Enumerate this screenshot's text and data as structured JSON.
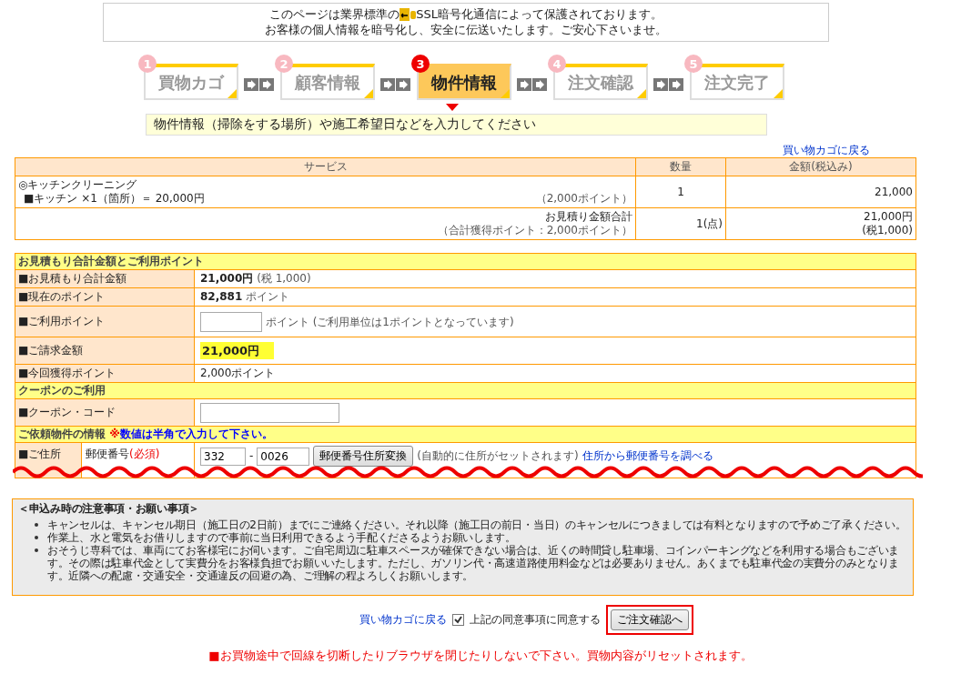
{
  "ssl_notice": {
    "line1_before": "このページは業界標準の",
    "line1_after": "SSL暗号化通信によって保護されております。",
    "line2": "お客様の個人情報を暗号化し、安全に伝送いたします。ご安心下さいませ。"
  },
  "steps": [
    {
      "number": "1",
      "label": "買物カゴ",
      "selected": false
    },
    {
      "number": "2",
      "label": "顧客情報",
      "selected": false
    },
    {
      "number": "3",
      "label": "物件情報",
      "selected": true
    },
    {
      "number": "4",
      "label": "注文確認",
      "selected": false
    },
    {
      "number": "5",
      "label": "注文完了",
      "selected": false
    }
  ],
  "instruction": "物件情報（掃除をする場所）や施工希望日などを入力してください",
  "back_link": "買い物カゴに戻る",
  "cart_table": {
    "columns": [
      "サービス",
      "数量",
      "金額(税込み)"
    ],
    "item": {
      "name": "◎キッチンクリーニング",
      "detail": "■キッチン ×1（箇所）＝ 20,000円",
      "points": "（2,000ポイント）",
      "quantity": "1",
      "amount": "21,000"
    },
    "total": {
      "label": "お見積り金額合計",
      "points": "（合計獲得ポイント：2,000ポイント）",
      "quantity": "1(点)",
      "amount": "21,000円",
      "tax": "(税1,000)"
    }
  },
  "form_rows": [
    {
      "kind": "section",
      "title": "お見積もり合計金額とご利用ポイント"
    },
    {
      "kind": "bold",
      "label": "■お見積もり合計金額",
      "value": "21,000円",
      "suffix": "(税 1,000)"
    },
    {
      "kind": "bold",
      "label": "■現在のポイント",
      "value": "82,881",
      "suffix": "ポイント"
    },
    {
      "kind": "input",
      "label": "■ご利用ポイント",
      "suffix": "ポイント (ご利用単位は1ポイントとなっています)"
    },
    {
      "kind": "highlight",
      "label": "■ご請求金額",
      "value": "21,000円"
    },
    {
      "kind": "plain",
      "label": "■今回獲得ポイント",
      "value": "2,000ポイント"
    },
    {
      "kind": "section",
      "title": "クーポンのご利用"
    },
    {
      "kind": "coupon",
      "label": "■クーポン・コード"
    },
    {
      "kind": "section",
      "title": "ご依頼物件の情報",
      "note": "※数値は半角で入力して下さい。"
    },
    {
      "kind": "address",
      "label": "■ご住所",
      "sublabel": "郵便番号",
      "required": "(必須)",
      "zip1": "332",
      "separator": "-",
      "zip2": "0026",
      "button": "郵便番号住所変換",
      "hint": "(自動的に住所がセットされます)",
      "link": "住所から郵便番号を調べる"
    }
  ],
  "notes": {
    "title": "＜申込み時の注意事項・お願い事項＞",
    "items": [
      "キャンセルは、キャンセル期日（施工日の2日前）までにご連絡ください。それ以降（施工日の前日・当日）のキャンセルにつきましては有料となりますので予めご了承ください。",
      "作業上、水と電気をお借りしますので事前に当日利用できるよう手配くださるようお願いします。",
      "おそうじ専科では、車両にてお客様宅にお伺います。ご自宅周辺に駐車スペースが確保できない場合は、近くの時間貸し駐車場、コインパーキングなどを利用する場合もございます。その際は駐車代金として実費分をお客様負担でお願いいたします。ただし、ガソリン代・高速道路使用料金などは必要ありません。あくまでも駐車代金の実費分のみとなります。近隣への配慮・交通安全・交通違反の回避の為、ご理解の程よろしくお願いします。"
    ]
  },
  "footer": {
    "back_link": "買い物カゴに戻る",
    "agree": {
      "label": "上記の同意事項に同意する",
      "checked": true
    },
    "confirm_button": "ご注文確認へ",
    "warning": "■お買物途中で回線を切断したりブラウザを閉じたりしないで下さい。買物内容がリセットされます。"
  }
}
